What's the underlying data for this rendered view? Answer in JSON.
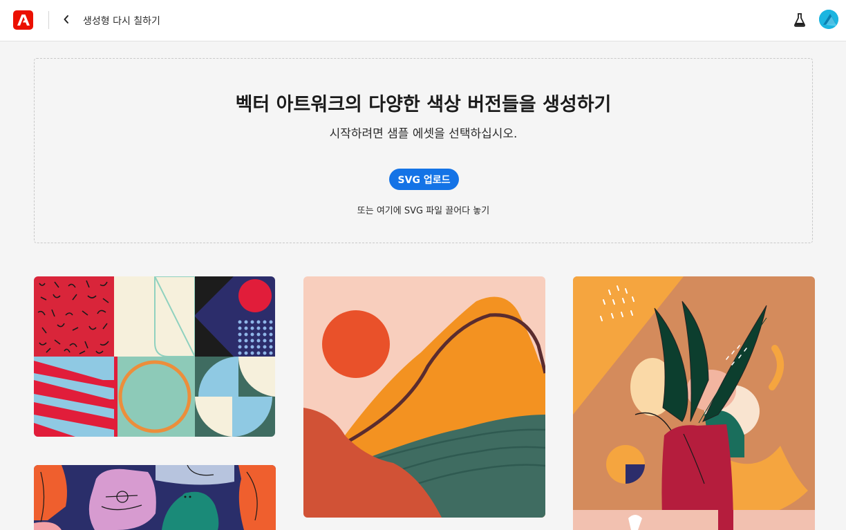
{
  "header": {
    "breadcrumb": "생성형 다시 칠하기",
    "logo_icon": "adobe-logo-icon",
    "back_icon": "chevron-left-icon",
    "labs_icon": "flask-icon",
    "avatar_icon": "user-avatar"
  },
  "dropzone": {
    "title": "벡터 아트워크의 다양한 색상 버전들을 생성하기",
    "subtitle": "시작하려면 샘플 에셋을 선택하십시오.",
    "upload_label": "SVG 업로드",
    "hint": "또는 여기에 SVG 파일 끌어다 놓기"
  },
  "samples": [
    {
      "name": "geometric-pattern-sample"
    },
    {
      "name": "abstract-landscape-sample"
    },
    {
      "name": "plant-vase-sample"
    },
    {
      "name": "characters-pattern-sample"
    }
  ],
  "colors": {
    "accent": "#1473e6",
    "brand": "#eb1000",
    "background": "#f5f5f5"
  }
}
